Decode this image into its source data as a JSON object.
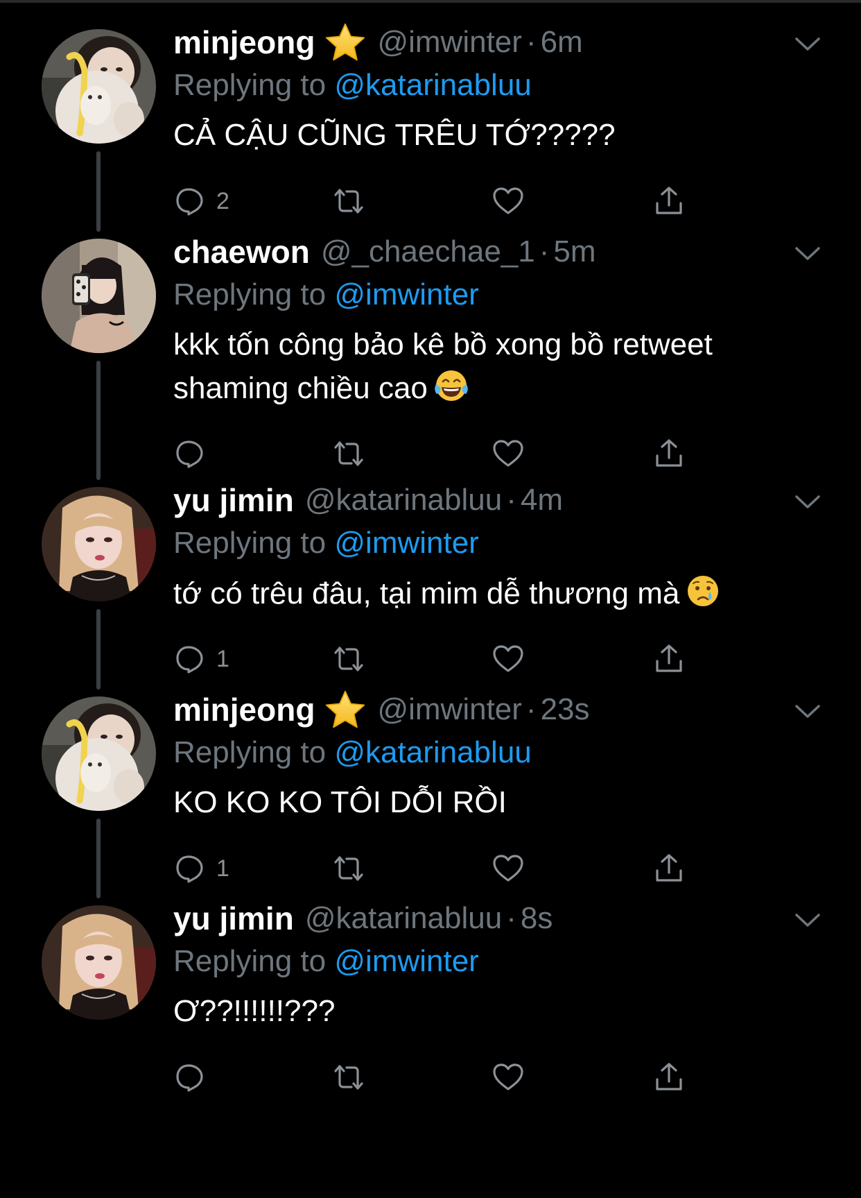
{
  "tweets": [
    {
      "name": "minjeong",
      "verified_star": true,
      "handle": "@imwinter",
      "separator": "·",
      "time": "6m",
      "replying_prefix": "Replying to",
      "replying_to": "@katarinabluu",
      "text": "CẢ CẬU CŨNG TRÊU TỚ?????",
      "emoji": "",
      "reply_count": "2",
      "avatar": "minjeong-avatar"
    },
    {
      "name": "chaewon",
      "verified_star": false,
      "handle": "@_chaechae_1",
      "separator": "·",
      "time": "5m",
      "replying_prefix": "Replying to",
      "replying_to": "@imwinter",
      "text": "kkk tốn công bảo kê bồ xong bồ retweet shaming chiều cao",
      "emoji": "face-with-tears-of-joy",
      "reply_count": "",
      "avatar": "chaewon-avatar"
    },
    {
      "name": "yu jimin",
      "verified_star": false,
      "handle": "@katarinabluu",
      "separator": "·",
      "time": "4m",
      "replying_prefix": "Replying to",
      "replying_to": "@imwinter",
      "text": "tớ có trêu đâu, tại mim dễ thương mà",
      "emoji": "crying-face",
      "reply_count": "1",
      "avatar": "jimin-avatar"
    },
    {
      "name": "minjeong",
      "verified_star": true,
      "handle": "@imwinter",
      "separator": "·",
      "time": "23s",
      "replying_prefix": "Replying to",
      "replying_to": "@katarinabluu",
      "text": "KO KO KO TÔI DỖI RỒI",
      "emoji": "",
      "reply_count": "1",
      "avatar": "minjeong-avatar"
    },
    {
      "name": "yu jimin",
      "verified_star": false,
      "handle": "@katarinabluu",
      "separator": "·",
      "time": "8s",
      "replying_prefix": "Replying to",
      "replying_to": "@imwinter",
      "text": "Ơ??!!!!!!???",
      "emoji": "",
      "reply_count": "",
      "avatar": "jimin-avatar"
    }
  ],
  "icons": {
    "reply": "reply-icon",
    "retweet": "retweet-icon",
    "like": "like-icon",
    "share": "share-icon",
    "more": "chevron-down-icon",
    "star": "star-emoji-icon"
  },
  "colors": {
    "background": "#000000",
    "text": "#ffffff",
    "muted": "#6e767d",
    "mention": "#1d9bf0",
    "thread_line": "#3b3f44",
    "icon": "#8b9197"
  }
}
